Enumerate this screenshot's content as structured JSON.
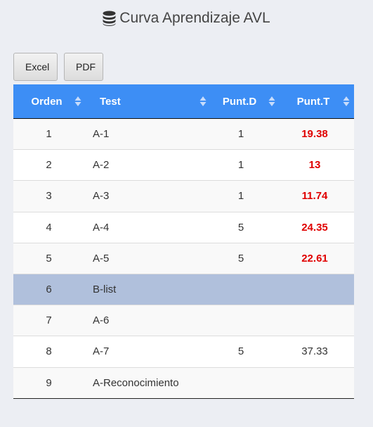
{
  "header": {
    "title": "Curva Aprendizaje AVL",
    "icon": "database-icon"
  },
  "toolbar": {
    "excel_label": "Excel",
    "pdf_label": "PDF"
  },
  "table": {
    "columns": [
      "Orden",
      "Test",
      "Punt.D",
      "Punt.T"
    ],
    "header_color": "#3d8ef5",
    "highlight_color": "#b0c0dc",
    "alert_color": "#e00000",
    "rows": [
      {
        "orden": "1",
        "test": "A-1",
        "punt_d": "1",
        "punt_t": "19.38",
        "alert": true
      },
      {
        "orden": "2",
        "test": "A-2",
        "punt_d": "1",
        "punt_t": "13",
        "alert": true
      },
      {
        "orden": "3",
        "test": "A-3",
        "punt_d": "1",
        "punt_t": "11.74",
        "alert": true
      },
      {
        "orden": "4",
        "test": "A-4",
        "punt_d": "5",
        "punt_t": "24.35",
        "alert": true
      },
      {
        "orden": "5",
        "test": "A-5",
        "punt_d": "5",
        "punt_t": "22.61",
        "alert": true
      },
      {
        "orden": "6",
        "test": "B-list",
        "punt_d": "",
        "punt_t": "",
        "highlight": true
      },
      {
        "orden": "7",
        "test": "A-6",
        "punt_d": "",
        "punt_t": ""
      },
      {
        "orden": "8",
        "test": "A-7",
        "punt_d": "5",
        "punt_t": "37.33"
      },
      {
        "orden": "9",
        "test": "A-Reconocimiento",
        "punt_d": "",
        "punt_t": ""
      }
    ]
  }
}
